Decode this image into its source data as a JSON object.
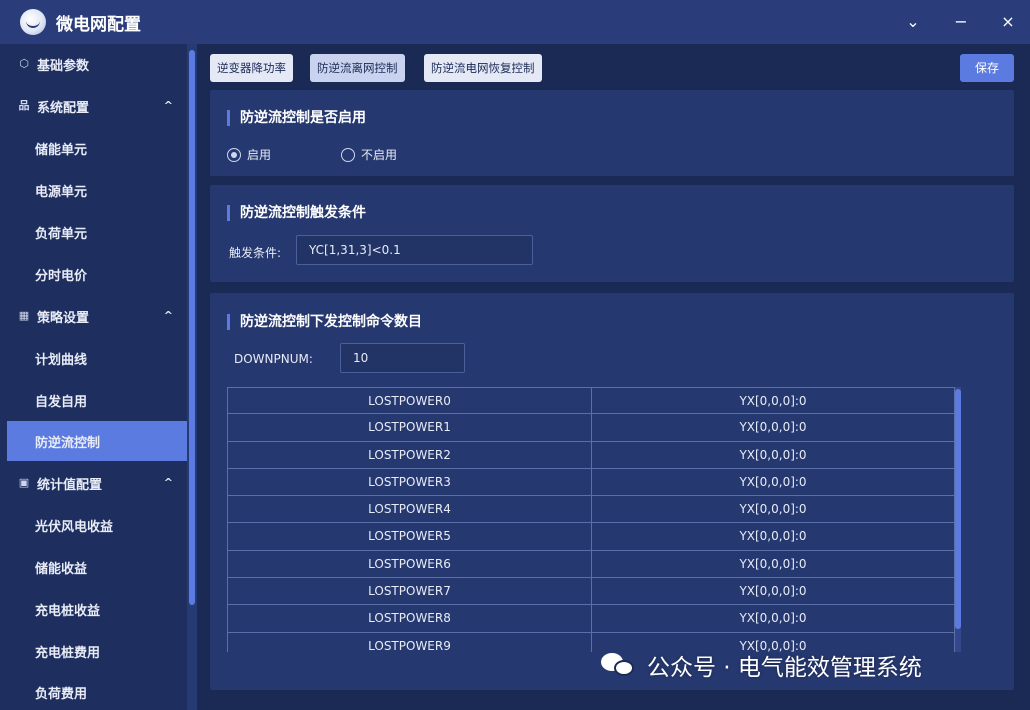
{
  "window": {
    "title": "微电网配置",
    "chevron_icon": "⌄",
    "minimize_icon": "−",
    "close_icon": "×"
  },
  "sidebar": {
    "items": [
      {
        "label": "基础参数",
        "icon": "cube-icon",
        "glyph": "⬡",
        "type": "group"
      },
      {
        "label": "系统配置",
        "icon": "grid-icon",
        "glyph": "品",
        "type": "group",
        "caret": "^"
      },
      {
        "label": "储能单元",
        "type": "sub"
      },
      {
        "label": "电源单元",
        "type": "sub"
      },
      {
        "label": "负荷单元",
        "type": "sub"
      },
      {
        "label": "分时电价",
        "type": "sub"
      },
      {
        "label": "策略设置",
        "icon": "chart-icon",
        "glyph": "▦",
        "type": "group",
        "caret": "^"
      },
      {
        "label": "计划曲线",
        "type": "sub"
      },
      {
        "label": "自发自用",
        "type": "sub"
      },
      {
        "label": "防逆流控制",
        "type": "sub",
        "active": true
      },
      {
        "label": "统计值配置",
        "icon": "monitor-icon",
        "glyph": "▣",
        "type": "group",
        "caret": "^"
      },
      {
        "label": "光伏风电收益",
        "type": "sub"
      },
      {
        "label": "储能收益",
        "type": "sub"
      },
      {
        "label": "充电桩收益",
        "type": "sub"
      },
      {
        "label": "充电桩费用",
        "type": "sub"
      },
      {
        "label": "负荷费用",
        "type": "sub"
      }
    ]
  },
  "tabs": [
    {
      "label": "逆变器降功率"
    },
    {
      "label": "防逆流离网控制",
      "active": true
    },
    {
      "label": "防逆流电网恢复控制"
    }
  ],
  "save_label": "保存",
  "enable_section": {
    "title": "防逆流控制是否启用",
    "options": [
      {
        "label": "启用",
        "selected": true
      },
      {
        "label": "不启用",
        "selected": false
      }
    ]
  },
  "trigger_section": {
    "title": "防逆流控制触发条件",
    "field_label": "触发条件:",
    "field_value": "YC[1,31,3]<0.1"
  },
  "command_section": {
    "title": "防逆流控制下发控制命令数目",
    "field_label": "DOWNPNUM:",
    "field_value": "10",
    "rows": [
      {
        "name": "LOSTPOWER0",
        "value": "YX[0,0,0]:0"
      },
      {
        "name": "LOSTPOWER1",
        "value": "YX[0,0,0]:0"
      },
      {
        "name": "LOSTPOWER2",
        "value": "YX[0,0,0]:0"
      },
      {
        "name": "LOSTPOWER3",
        "value": "YX[0,0,0]:0"
      },
      {
        "name": "LOSTPOWER4",
        "value": "YX[0,0,0]:0"
      },
      {
        "name": "LOSTPOWER5",
        "value": "YX[0,0,0]:0"
      },
      {
        "name": "LOSTPOWER6",
        "value": "YX[0,0,0]:0"
      },
      {
        "name": "LOSTPOWER7",
        "value": "YX[0,0,0]:0"
      },
      {
        "name": "LOSTPOWER8",
        "value": "YX[0,0,0]:0"
      },
      {
        "name": "LOSTPOWER9",
        "value": "YX[0,0,0]:0"
      }
    ]
  },
  "watermark": {
    "icon": "wechat-icon",
    "text": "公众号 · 电气能效管理系统"
  },
  "colors": {
    "background": "#1b2a55",
    "titlebar": "#2a3d7a",
    "panel": "#263870",
    "accent": "#5b7be0"
  }
}
